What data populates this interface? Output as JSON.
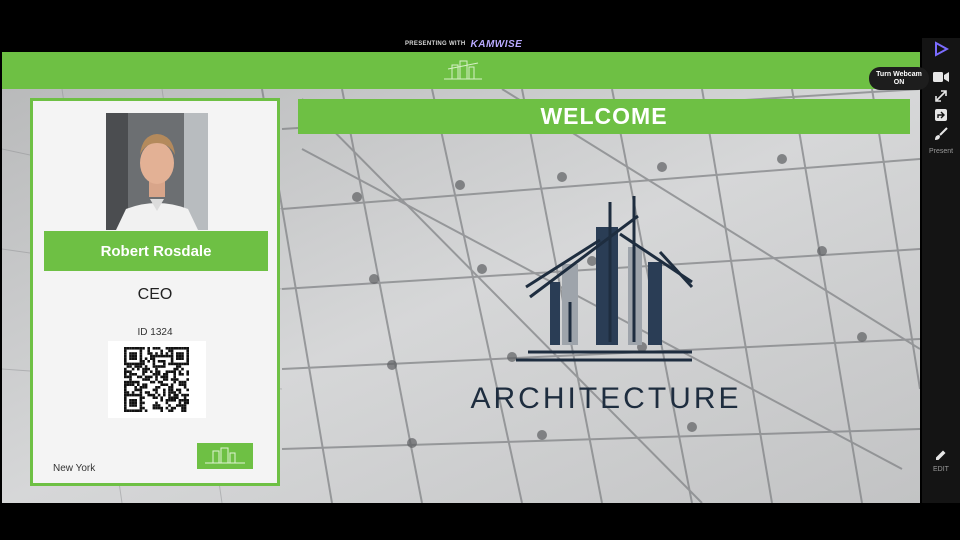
{
  "header": {
    "presenting_label": "PRESENTING WITH",
    "brand": "KAMWISE"
  },
  "badge": {
    "name": "Robert Rosdale",
    "role": "CEO",
    "id_text": "ID 1324",
    "city": "New York"
  },
  "slide": {
    "welcome": "WELCOME",
    "logo_text": "ARCHITECTURE"
  },
  "sidebar": {
    "webcam_tooltip_line1": "Turn Webcam",
    "webcam_tooltip_line2": "ON",
    "present_label": "Present",
    "edit_label": "EDIT",
    "icons": [
      "present-icon",
      "webcam-icon",
      "fullscreen-icon",
      "share-screen-icon",
      "brush-icon",
      "edit-icon"
    ]
  },
  "colors": {
    "accent": "#6ec044",
    "brand": "#b9a9ff",
    "dark_text": "#1e2d3f"
  }
}
